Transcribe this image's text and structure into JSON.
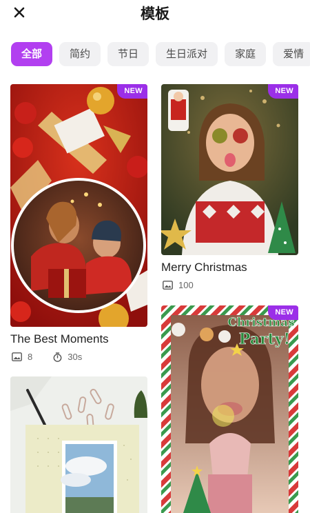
{
  "header": {
    "title": "模板",
    "close_icon": "close-icon"
  },
  "categories": [
    {
      "label": "全部",
      "active": true
    },
    {
      "label": "简约",
      "active": false
    },
    {
      "label": "节日",
      "active": false
    },
    {
      "label": "生日派对",
      "active": false
    },
    {
      "label": "家庭",
      "active": false
    },
    {
      "label": "爱情",
      "active": false
    }
  ],
  "templates": {
    "best_moments": {
      "badge": "NEW",
      "title": "The Best Moments",
      "photos": "8",
      "duration": "30s"
    },
    "merry_christmas": {
      "badge": "NEW",
      "title": "Merry Christmas",
      "photos": "100"
    },
    "christmas_party": {
      "badge": "NEW"
    },
    "notebook": {}
  },
  "colors": {
    "accent": "#b23ff0",
    "badge": "#9b2fe8",
    "chip_bg": "#f1f1f3"
  }
}
